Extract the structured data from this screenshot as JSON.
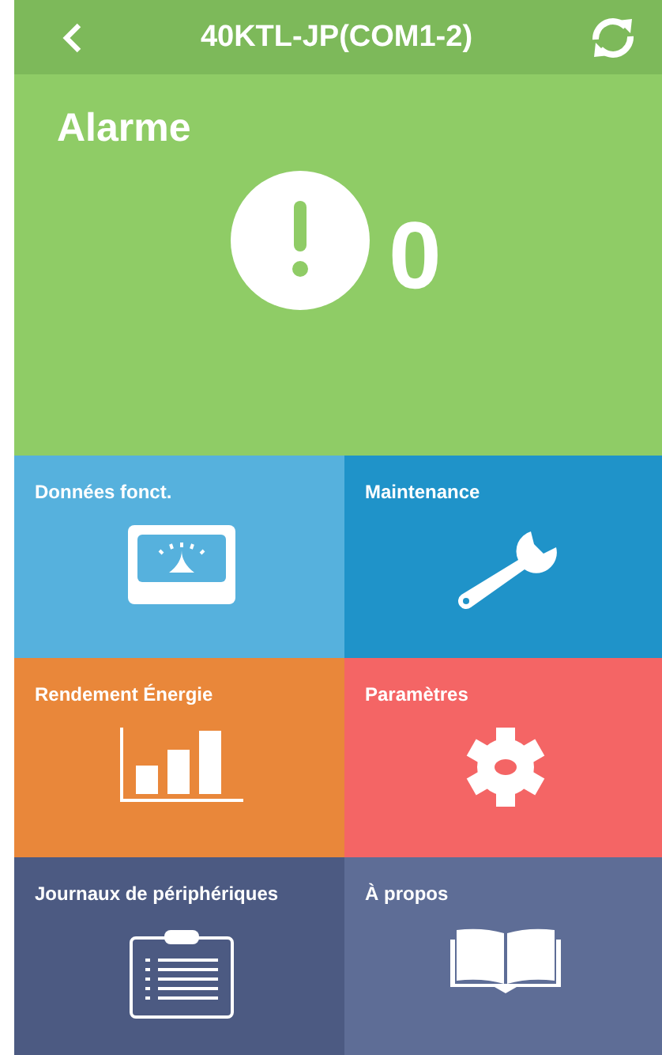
{
  "header": {
    "title": "40KTL-JP(COM1-2)"
  },
  "alarm": {
    "title": "Alarme",
    "count": "0"
  },
  "tiles": [
    {
      "kind": "meter",
      "label": "Données fonct.",
      "color": "#56b1dd"
    },
    {
      "kind": "wrench",
      "label": "Maintenance",
      "color": "#1f93c9"
    },
    {
      "kind": "chart",
      "label": "Rendement Énergie",
      "color": "#e9873a"
    },
    {
      "kind": "gear",
      "label": "Paramètres",
      "color": "#f46565"
    },
    {
      "kind": "clipboard",
      "label": "Journaux de périphériques",
      "color": "#4c5a82"
    },
    {
      "kind": "book",
      "label": "À propos",
      "color": "#5e6d96"
    }
  ]
}
